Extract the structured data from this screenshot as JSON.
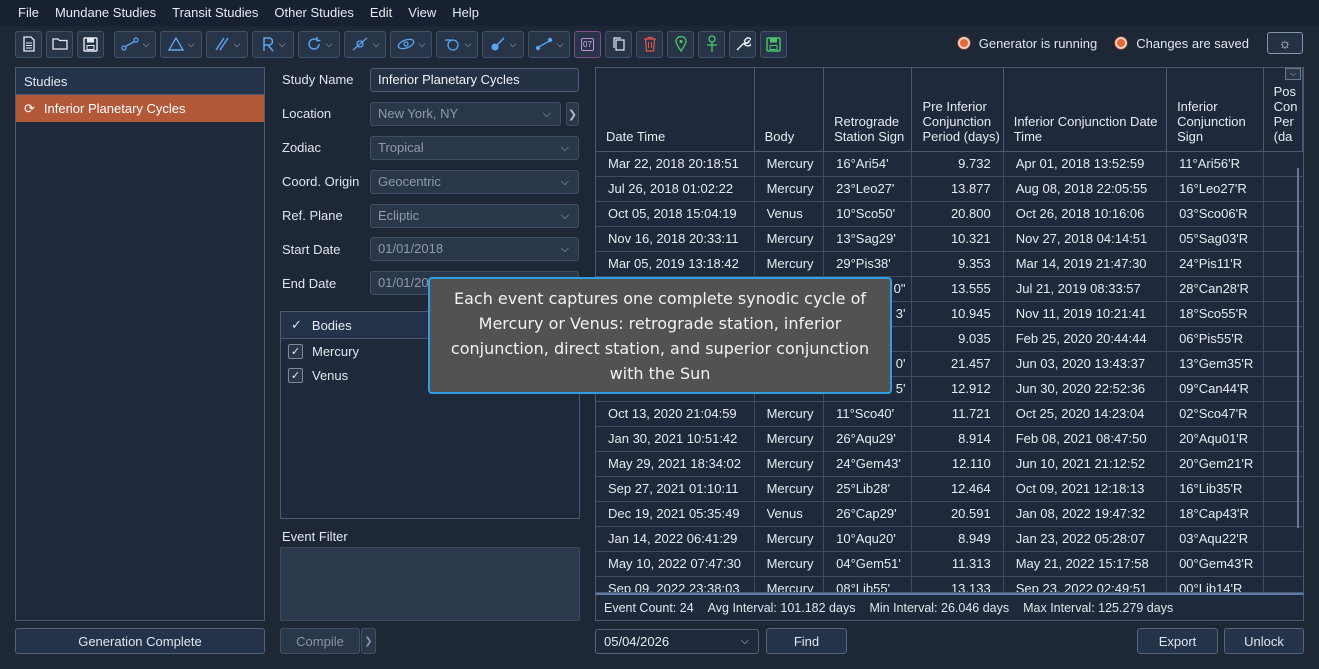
{
  "menu": [
    "File",
    "Mundane Studies",
    "Transit Studies",
    "Other Studies",
    "Edit",
    "View",
    "Help"
  ],
  "toolbar": {
    "icons": [
      "new-file-icon",
      "open-folder-icon",
      "save-icon",
      "aspects-icon",
      "triangle-icon",
      "parallel-icon",
      "retrograde-icon",
      "cycle-icon",
      "eclipse-icon",
      "orbit-icon",
      "lunar-icon",
      "planet-icon",
      "path-icon",
      "calendar-icon",
      "copy-icon",
      "delete-icon",
      "location-icon",
      "ankh-icon",
      "wrench-icon",
      "save-db-icon"
    ],
    "calendar_label": "07"
  },
  "status": {
    "generator": "Generator is running",
    "saved": "Changes are saved",
    "dot_color": "#e26b3e"
  },
  "studies": {
    "header": "Studies",
    "items": [
      "Inferior Planetary Cycles"
    ]
  },
  "generation_button": "Generation Complete",
  "form": {
    "study_name_label": "Study Name",
    "study_name": "Inferior Planetary Cycles",
    "location_label": "Location",
    "location": "New York, NY",
    "zodiac_label": "Zodiac",
    "zodiac": "Tropical",
    "coord_label": "Coord. Origin",
    "coord": "Geocentric",
    "ref_plane_label": "Ref. Plane",
    "ref_plane": "Ecliptic",
    "start_date_label": "Start Date",
    "start_date": "01/01/2018",
    "end_date_label": "End Date",
    "end_date": "01/01/20"
  },
  "bodies": {
    "header": "Bodies",
    "items": [
      "Mercury",
      "Venus"
    ]
  },
  "event_filter_label": "Event Filter",
  "compile_button": "Compile",
  "table": {
    "headers": [
      "Date Time",
      "Body",
      "Retrograde Station Sign",
      "Pre Inferior Conjunction Period (days)",
      "Inferior Conjunction Date Time",
      "Inferior Conjunction Sign",
      "Pos Con Per (da"
    ],
    "rows": [
      [
        "Mar 22, 2018 20:18:51",
        "Mercury",
        "16°Ari54'",
        "9.732",
        "Apr 01, 2018 13:52:59",
        "11°Ari56'R"
      ],
      [
        "Jul 26, 2018 01:02:22",
        "Mercury",
        "23°Leo27'",
        "13.877",
        "Aug 08, 2018 22:05:55",
        "16°Leo27'R"
      ],
      [
        "Oct 05, 2018 15:04:19",
        "Venus",
        "10°Sco50'",
        "20.800",
        "Oct 26, 2018 10:16:06",
        "03°Sco06'R"
      ],
      [
        "Nov 16, 2018 20:33:11",
        "Mercury",
        "13°Sag29'",
        "10.321",
        "Nov 27, 2018 04:14:51",
        "05°Sag03'R"
      ],
      [
        "Mar 05, 2019 13:18:42",
        "Mercury",
        "29°Pis38'",
        "9.353",
        "Mar 14, 2019 21:47:30",
        "24°Pis11'R"
      ],
      [
        "",
        "",
        "",
        "13.555",
        "Jul 21, 2019 08:33:57",
        "28°Can28'R"
      ],
      [
        "",
        "",
        "",
        "10.945",
        "Nov 11, 2019 10:21:41",
        "18°Sco55'R"
      ],
      [
        "",
        "",
        "",
        "9.035",
        "Feb 25, 2020 20:44:44",
        "06°Pis55'R"
      ],
      [
        "",
        "",
        "",
        "21.457",
        "Jun 03, 2020 13:43:37",
        "13°Gem35'R"
      ],
      [
        "",
        "",
        "",
        "12.912",
        "Jun 30, 2020 22:52:36",
        "09°Can44'R"
      ],
      [
        "Oct 13, 2020 21:04:59",
        "Mercury",
        "11°Sco40'",
        "11.721",
        "Oct 25, 2020 14:23:04",
        "02°Sco47'R"
      ],
      [
        "Jan 30, 2021 10:51:42",
        "Mercury",
        "26°Aqu29'",
        "8.914",
        "Feb 08, 2021 08:47:50",
        "20°Aqu01'R"
      ],
      [
        "May 29, 2021 18:34:02",
        "Mercury",
        "24°Gem43'",
        "12.110",
        "Jun 10, 2021 21:12:52",
        "20°Gem21'R"
      ],
      [
        "Sep 27, 2021 01:10:11",
        "Mercury",
        "25°Lib28'",
        "12.464",
        "Oct 09, 2021 12:18:13",
        "16°Lib35'R"
      ],
      [
        "Dec 19, 2021 05:35:49",
        "Venus",
        "26°Cap29'",
        "20.591",
        "Jan 08, 2022 19:47:32",
        "18°Cap43'R"
      ],
      [
        "Jan 14, 2022 06:41:29",
        "Mercury",
        "10°Aqu20'",
        "8.949",
        "Jan 23, 2022 05:28:07",
        "03°Aqu22'R"
      ],
      [
        "May 10, 2022 07:47:30",
        "Mercury",
        "04°Gem51'",
        "11.313",
        "May 21, 2022 15:17:58",
        "00°Gem43'R"
      ],
      [
        "Sep 09, 2022 23:38:03",
        "Mercury",
        "08°Lib55'",
        "13.133",
        "Sep 23, 2022 02:49:51",
        "00°Lib14'R"
      ]
    ],
    "partial_cells": [
      "0\"",
      "3'",
      "0'",
      "5'"
    ]
  },
  "stats": {
    "event_count": "Event Count:  24",
    "avg": "Avg Interval:  101.182 days",
    "min": "Min Interval:  26.046 days",
    "max": "Max Interval:  125.279 days"
  },
  "bottom": {
    "date": "05/04/2026",
    "find": "Find",
    "export": "Export",
    "unlock": "Unlock"
  },
  "tooltip": "Each event captures one complete synodic cycle of Mercury or Venus: retrograde station, inferior conjunction, direct station, and superior conjunction with the Sun"
}
